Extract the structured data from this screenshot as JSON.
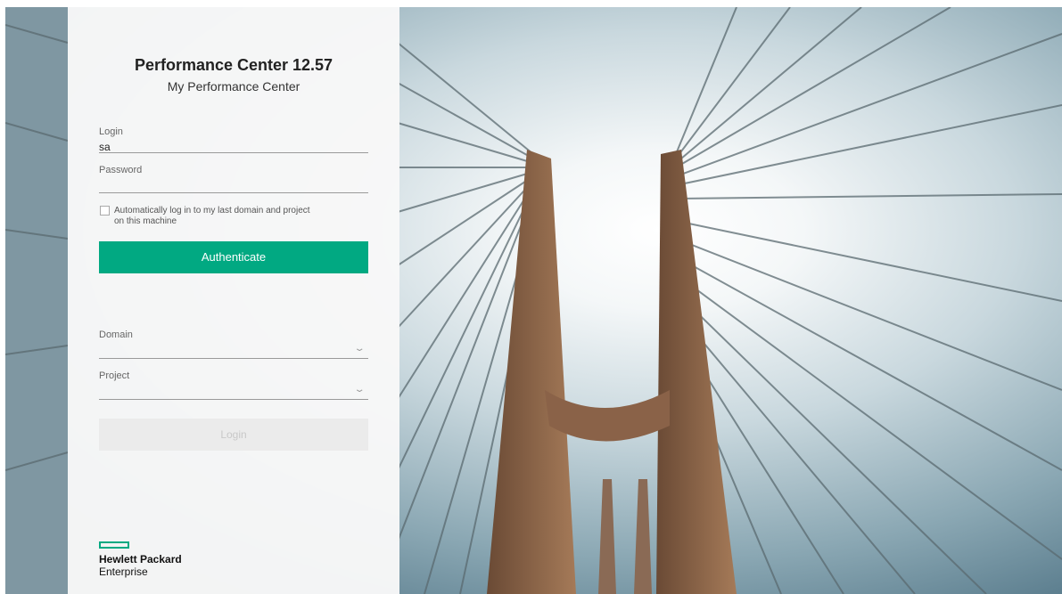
{
  "app": {
    "title": "Performance Center 12.57",
    "subtitle": "My Performance Center"
  },
  "form": {
    "login_label": "Login",
    "login_value": "sa",
    "password_label": "Password",
    "password_value": "",
    "auto_login_label": "Automatically log in to my last domain and project on this machine",
    "auto_login_checked": false,
    "authenticate_label": "Authenticate",
    "domain_label": "Domain",
    "domain_value": "",
    "project_label": "Project",
    "project_value": "",
    "login_button_label": "Login"
  },
  "brand": {
    "line1": "Hewlett Packard",
    "line2": "Enterprise",
    "accent_color": "#01a982"
  }
}
